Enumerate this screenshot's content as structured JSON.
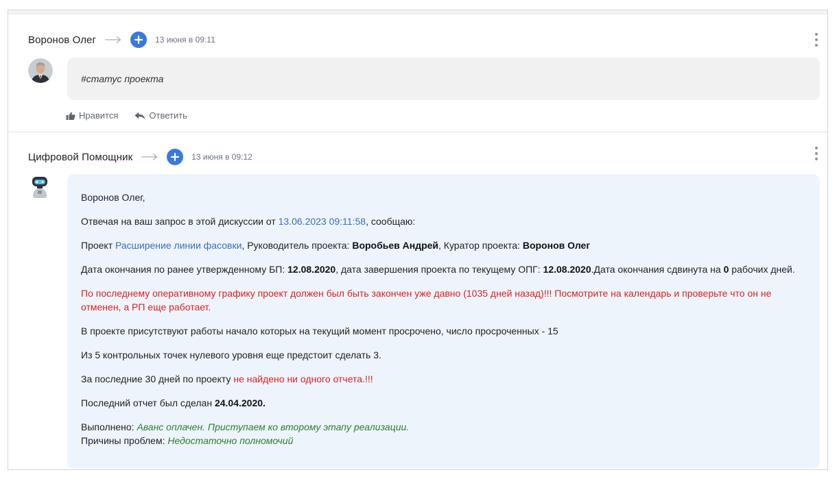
{
  "post1": {
    "author": "Воронов Олег",
    "timestamp": "13 июня в 09:11",
    "text": "#статус проекта",
    "like_label": "Нравится",
    "reply_label": "Ответить"
  },
  "post2": {
    "author": "Цифровой Помощник",
    "timestamp": "13 июня в 09:12",
    "greeting": "Воронов Олег,",
    "line2_prefix": "Отвечая на ваш запрос в этой дискуссии от ",
    "line2_link": "13.06.2023 09:11:58",
    "line2_suffix": ", сообщаю:",
    "line3_prefix": "Проект ",
    "line3_link": "Расширение линии фасовки",
    "line3_mid1": ", Руководитель проекта: ",
    "line3_manager": "Воробьев Андрей",
    "line3_mid2": ", Куратор проекта: ",
    "line3_curator": "Воронов Олег",
    "line4_prefix": "Дата окончания по ранее утвержденному БП: ",
    "line4_date1": "12.08.2020",
    "line4_mid": ", дата завершения проекта по текущему ОПГ: ",
    "line4_date2": "12.08.2020",
    "line4_mid2": ".Дата окончания сдвинута на ",
    "line4_days": "0",
    "line4_suffix": " рабочих дней.",
    "warning": "По последнему оперативному графику проект должен был быть закончен уже давно (1035 дней назад)!!! Посмотрите на календарь и проверьте что он не отменен, а РП еще работает.",
    "overdue": "В проекте присутствуют работы начало которых на текущий момент просрочено, число просроченных - 15",
    "checkpoints": "Из 5 контрольных точек нулевого уровня еще предстоит сделать 3.",
    "reports_prefix": "За последние 30 дней по проекту ",
    "reports_red": "не найдено ни одного отчета.!!!",
    "last_report_prefix": "Последний отчет был сделан ",
    "last_report_date": "24.04.2020.",
    "done_label": "Выполнено: ",
    "done_text": "Аванс оплачен. Приступаем ко второму этапу реализации.",
    "problems_label": "Причины проблем: ",
    "problems_text": "Недостаточно полномочий"
  },
  "colors": {
    "accent": "#3a79dc",
    "link": "#3a6fbe",
    "warning": "#e02020",
    "success": "#2e7d32",
    "bot_bubble": "#eef4fc",
    "user_bubble": "#f1f1f2"
  }
}
